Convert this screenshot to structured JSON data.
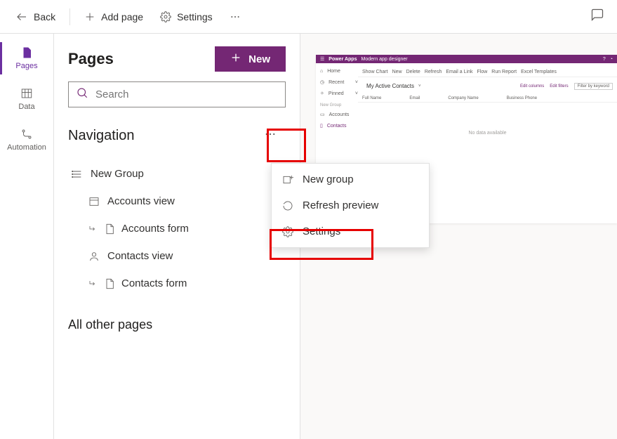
{
  "toolbar": {
    "back": "Back",
    "add_page": "Add page",
    "settings": "Settings"
  },
  "rail": {
    "pages": "Pages",
    "data": "Data",
    "automation": "Automation"
  },
  "panel": {
    "title": "Pages",
    "new_btn": "New",
    "search_placeholder": "Search",
    "navigation_title": "Navigation",
    "other_pages": "All other pages"
  },
  "nav": {
    "group": "New Group",
    "items": [
      {
        "label": "Accounts view"
      },
      {
        "label": "Accounts form"
      },
      {
        "label": "Contacts view"
      },
      {
        "label": "Contacts form"
      }
    ]
  },
  "ctx": {
    "new_group": "New group",
    "refresh": "Refresh preview",
    "settings": "Settings"
  },
  "preview": {
    "brand": "Power Apps",
    "app_name": "Modern app designer",
    "sidebar": [
      "Home",
      "Recent",
      "Pinned"
    ],
    "sidebar_group": "New Group",
    "sidebar_items": [
      "Accounts",
      "Contacts"
    ],
    "toolbar": [
      "Show Chart",
      "New",
      "Delete",
      "Refresh",
      "Email a Link",
      "Flow",
      "Run Report",
      "Excel Templates"
    ],
    "view_title": "My Active Contacts",
    "btns": [
      "Edit columns",
      "Edit filters"
    ],
    "filter_placeholder": "Filter by keyword",
    "columns": [
      "Full Name",
      "Email",
      "Company Name",
      "Business Phone"
    ],
    "empty": "No data available"
  }
}
